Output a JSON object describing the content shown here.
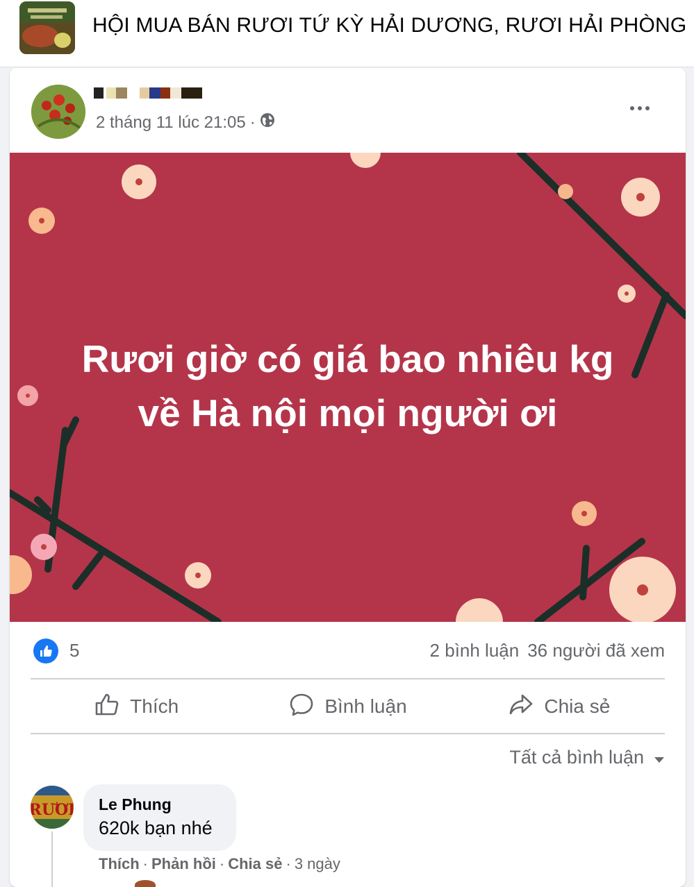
{
  "group": {
    "title": "HỘI MUA BÁN RƯƠI TỨ KỲ HẢI DƯƠNG, RƯƠI HẢI PHÒNG"
  },
  "post": {
    "timestamp": "2 tháng 11 lúc 21:05",
    "separator": "·",
    "privacy_icon": "globe-icon",
    "more_icon": "more-icon",
    "image_text_line1": "Rươi giờ có giá bao nhiêu kg",
    "image_text_line2": "về Hà nội mọi người ơi",
    "image_bg_color": "#b4354a"
  },
  "stats": {
    "like_count": "5",
    "comments": "2 bình luận",
    "views": "36 người đã xem"
  },
  "actions": {
    "like": "Thích",
    "comment": "Bình luận",
    "share": "Chia sẻ"
  },
  "comments_sort": {
    "label": "Tất cả bình luận"
  },
  "comment": {
    "author": "Le Phung",
    "text": "620k bạn nhé",
    "like": "Thích",
    "reply": "Phản hồi",
    "share": "Chia sẻ",
    "time": "3 ngày",
    "dot": "·",
    "avatar_text": "RƯƠI"
  },
  "colors": {
    "accent": "#1877f2",
    "secondary_text": "#65676b"
  }
}
